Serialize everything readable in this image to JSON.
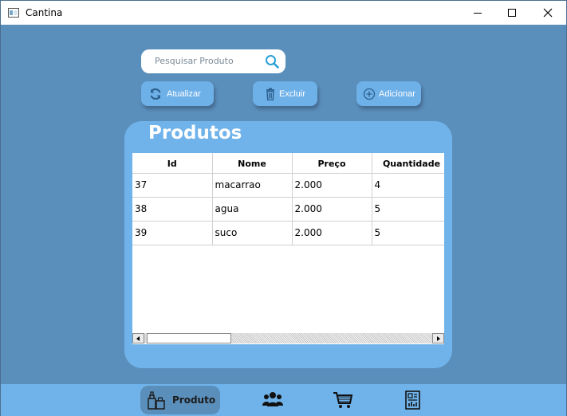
{
  "window": {
    "title": "Cantina",
    "minimize_glyph": "—",
    "maximize_glyph": "☐",
    "close_glyph": "✕"
  },
  "search": {
    "placeholder": "Pesquisar Produto",
    "icon": "search-icon"
  },
  "toolbar": {
    "refresh_label": "Atualizar",
    "refresh_icon": "refresh-icon",
    "delete_label": "Excluir",
    "delete_icon": "trash-icon",
    "add_label": "Adicionar",
    "add_icon": "plus-circle-icon"
  },
  "panel": {
    "title": "Produtos"
  },
  "table": {
    "columns": [
      "Id",
      "Nome",
      "Preço",
      "Quantidade"
    ],
    "rows": [
      [
        "37",
        "macarrao",
        "2.000",
        "4"
      ],
      [
        "38",
        "agua",
        "2.000",
        "5"
      ],
      [
        "39",
        "suco",
        "2.000",
        "5"
      ]
    ],
    "horizontal_scroll_position": 0.05
  },
  "nav": {
    "active_label": "Produto",
    "items": [
      {
        "icon": "products-icon",
        "label": "Produto",
        "active": true
      },
      {
        "icon": "users-icon"
      },
      {
        "icon": "cart-icon"
      },
      {
        "icon": "report-icon"
      }
    ]
  },
  "colors": {
    "background": "#5b8fbb",
    "panel": "#6fb3ea",
    "accent_icon": "#2a9fd6"
  }
}
